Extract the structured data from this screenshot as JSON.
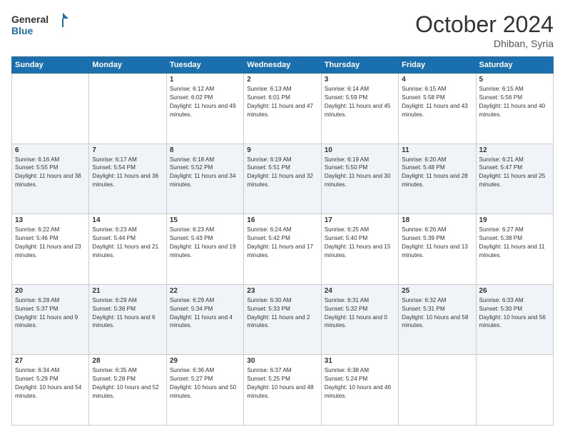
{
  "header": {
    "logo_line1": "General",
    "logo_line2": "Blue",
    "month": "October 2024",
    "location": "Dhiban, Syria"
  },
  "days_of_week": [
    "Sunday",
    "Monday",
    "Tuesday",
    "Wednesday",
    "Thursday",
    "Friday",
    "Saturday"
  ],
  "weeks": [
    [
      {
        "day": "",
        "sunrise": "",
        "sunset": "",
        "daylight": ""
      },
      {
        "day": "",
        "sunrise": "",
        "sunset": "",
        "daylight": ""
      },
      {
        "day": "1",
        "sunrise": "Sunrise: 6:12 AM",
        "sunset": "Sunset: 6:02 PM",
        "daylight": "Daylight: 11 hours and 49 minutes."
      },
      {
        "day": "2",
        "sunrise": "Sunrise: 6:13 AM",
        "sunset": "Sunset: 6:01 PM",
        "daylight": "Daylight: 11 hours and 47 minutes."
      },
      {
        "day": "3",
        "sunrise": "Sunrise: 6:14 AM",
        "sunset": "Sunset: 5:59 PM",
        "daylight": "Daylight: 11 hours and 45 minutes."
      },
      {
        "day": "4",
        "sunrise": "Sunrise: 6:15 AM",
        "sunset": "Sunset: 5:58 PM",
        "daylight": "Daylight: 11 hours and 43 minutes."
      },
      {
        "day": "5",
        "sunrise": "Sunrise: 6:15 AM",
        "sunset": "Sunset: 5:56 PM",
        "daylight": "Daylight: 11 hours and 40 minutes."
      }
    ],
    [
      {
        "day": "6",
        "sunrise": "Sunrise: 6:16 AM",
        "sunset": "Sunset: 5:55 PM",
        "daylight": "Daylight: 11 hours and 38 minutes."
      },
      {
        "day": "7",
        "sunrise": "Sunrise: 6:17 AM",
        "sunset": "Sunset: 5:54 PM",
        "daylight": "Daylight: 11 hours and 36 minutes."
      },
      {
        "day": "8",
        "sunrise": "Sunrise: 6:18 AM",
        "sunset": "Sunset: 5:52 PM",
        "daylight": "Daylight: 11 hours and 34 minutes."
      },
      {
        "day": "9",
        "sunrise": "Sunrise: 6:19 AM",
        "sunset": "Sunset: 5:51 PM",
        "daylight": "Daylight: 11 hours and 32 minutes."
      },
      {
        "day": "10",
        "sunrise": "Sunrise: 6:19 AM",
        "sunset": "Sunset: 5:50 PM",
        "daylight": "Daylight: 11 hours and 30 minutes."
      },
      {
        "day": "11",
        "sunrise": "Sunrise: 6:20 AM",
        "sunset": "Sunset: 5:48 PM",
        "daylight": "Daylight: 11 hours and 28 minutes."
      },
      {
        "day": "12",
        "sunrise": "Sunrise: 6:21 AM",
        "sunset": "Sunset: 5:47 PM",
        "daylight": "Daylight: 11 hours and 25 minutes."
      }
    ],
    [
      {
        "day": "13",
        "sunrise": "Sunrise: 6:22 AM",
        "sunset": "Sunset: 5:46 PM",
        "daylight": "Daylight: 11 hours and 23 minutes."
      },
      {
        "day": "14",
        "sunrise": "Sunrise: 6:23 AM",
        "sunset": "Sunset: 5:44 PM",
        "daylight": "Daylight: 11 hours and 21 minutes."
      },
      {
        "day": "15",
        "sunrise": "Sunrise: 6:23 AM",
        "sunset": "Sunset: 5:43 PM",
        "daylight": "Daylight: 11 hours and 19 minutes."
      },
      {
        "day": "16",
        "sunrise": "Sunrise: 6:24 AM",
        "sunset": "Sunset: 5:42 PM",
        "daylight": "Daylight: 11 hours and 17 minutes."
      },
      {
        "day": "17",
        "sunrise": "Sunrise: 6:25 AM",
        "sunset": "Sunset: 5:40 PM",
        "daylight": "Daylight: 11 hours and 15 minutes."
      },
      {
        "day": "18",
        "sunrise": "Sunrise: 6:26 AM",
        "sunset": "Sunset: 5:39 PM",
        "daylight": "Daylight: 11 hours and 13 minutes."
      },
      {
        "day": "19",
        "sunrise": "Sunrise: 6:27 AM",
        "sunset": "Sunset: 5:38 PM",
        "daylight": "Daylight: 11 hours and 11 minutes."
      }
    ],
    [
      {
        "day": "20",
        "sunrise": "Sunrise: 6:28 AM",
        "sunset": "Sunset: 5:37 PM",
        "daylight": "Daylight: 11 hours and 9 minutes."
      },
      {
        "day": "21",
        "sunrise": "Sunrise: 6:29 AM",
        "sunset": "Sunset: 5:36 PM",
        "daylight": "Daylight: 11 hours and 6 minutes."
      },
      {
        "day": "22",
        "sunrise": "Sunrise: 6:29 AM",
        "sunset": "Sunset: 5:34 PM",
        "daylight": "Daylight: 11 hours and 4 minutes."
      },
      {
        "day": "23",
        "sunrise": "Sunrise: 6:30 AM",
        "sunset": "Sunset: 5:33 PM",
        "daylight": "Daylight: 11 hours and 2 minutes."
      },
      {
        "day": "24",
        "sunrise": "Sunrise: 6:31 AM",
        "sunset": "Sunset: 5:32 PM",
        "daylight": "Daylight: 11 hours and 0 minutes."
      },
      {
        "day": "25",
        "sunrise": "Sunrise: 6:32 AM",
        "sunset": "Sunset: 5:31 PM",
        "daylight": "Daylight: 10 hours and 58 minutes."
      },
      {
        "day": "26",
        "sunrise": "Sunrise: 6:33 AM",
        "sunset": "Sunset: 5:30 PM",
        "daylight": "Daylight: 10 hours and 56 minutes."
      }
    ],
    [
      {
        "day": "27",
        "sunrise": "Sunrise: 6:34 AM",
        "sunset": "Sunset: 5:29 PM",
        "daylight": "Daylight: 10 hours and 54 minutes."
      },
      {
        "day": "28",
        "sunrise": "Sunrise: 6:35 AM",
        "sunset": "Sunset: 5:28 PM",
        "daylight": "Daylight: 10 hours and 52 minutes."
      },
      {
        "day": "29",
        "sunrise": "Sunrise: 6:36 AM",
        "sunset": "Sunset: 5:27 PM",
        "daylight": "Daylight: 10 hours and 50 minutes."
      },
      {
        "day": "30",
        "sunrise": "Sunrise: 6:37 AM",
        "sunset": "Sunset: 5:25 PM",
        "daylight": "Daylight: 10 hours and 48 minutes."
      },
      {
        "day": "31",
        "sunrise": "Sunrise: 6:38 AM",
        "sunset": "Sunset: 5:24 PM",
        "daylight": "Daylight: 10 hours and 46 minutes."
      },
      {
        "day": "",
        "sunrise": "",
        "sunset": "",
        "daylight": ""
      },
      {
        "day": "",
        "sunrise": "",
        "sunset": "",
        "daylight": ""
      }
    ]
  ]
}
